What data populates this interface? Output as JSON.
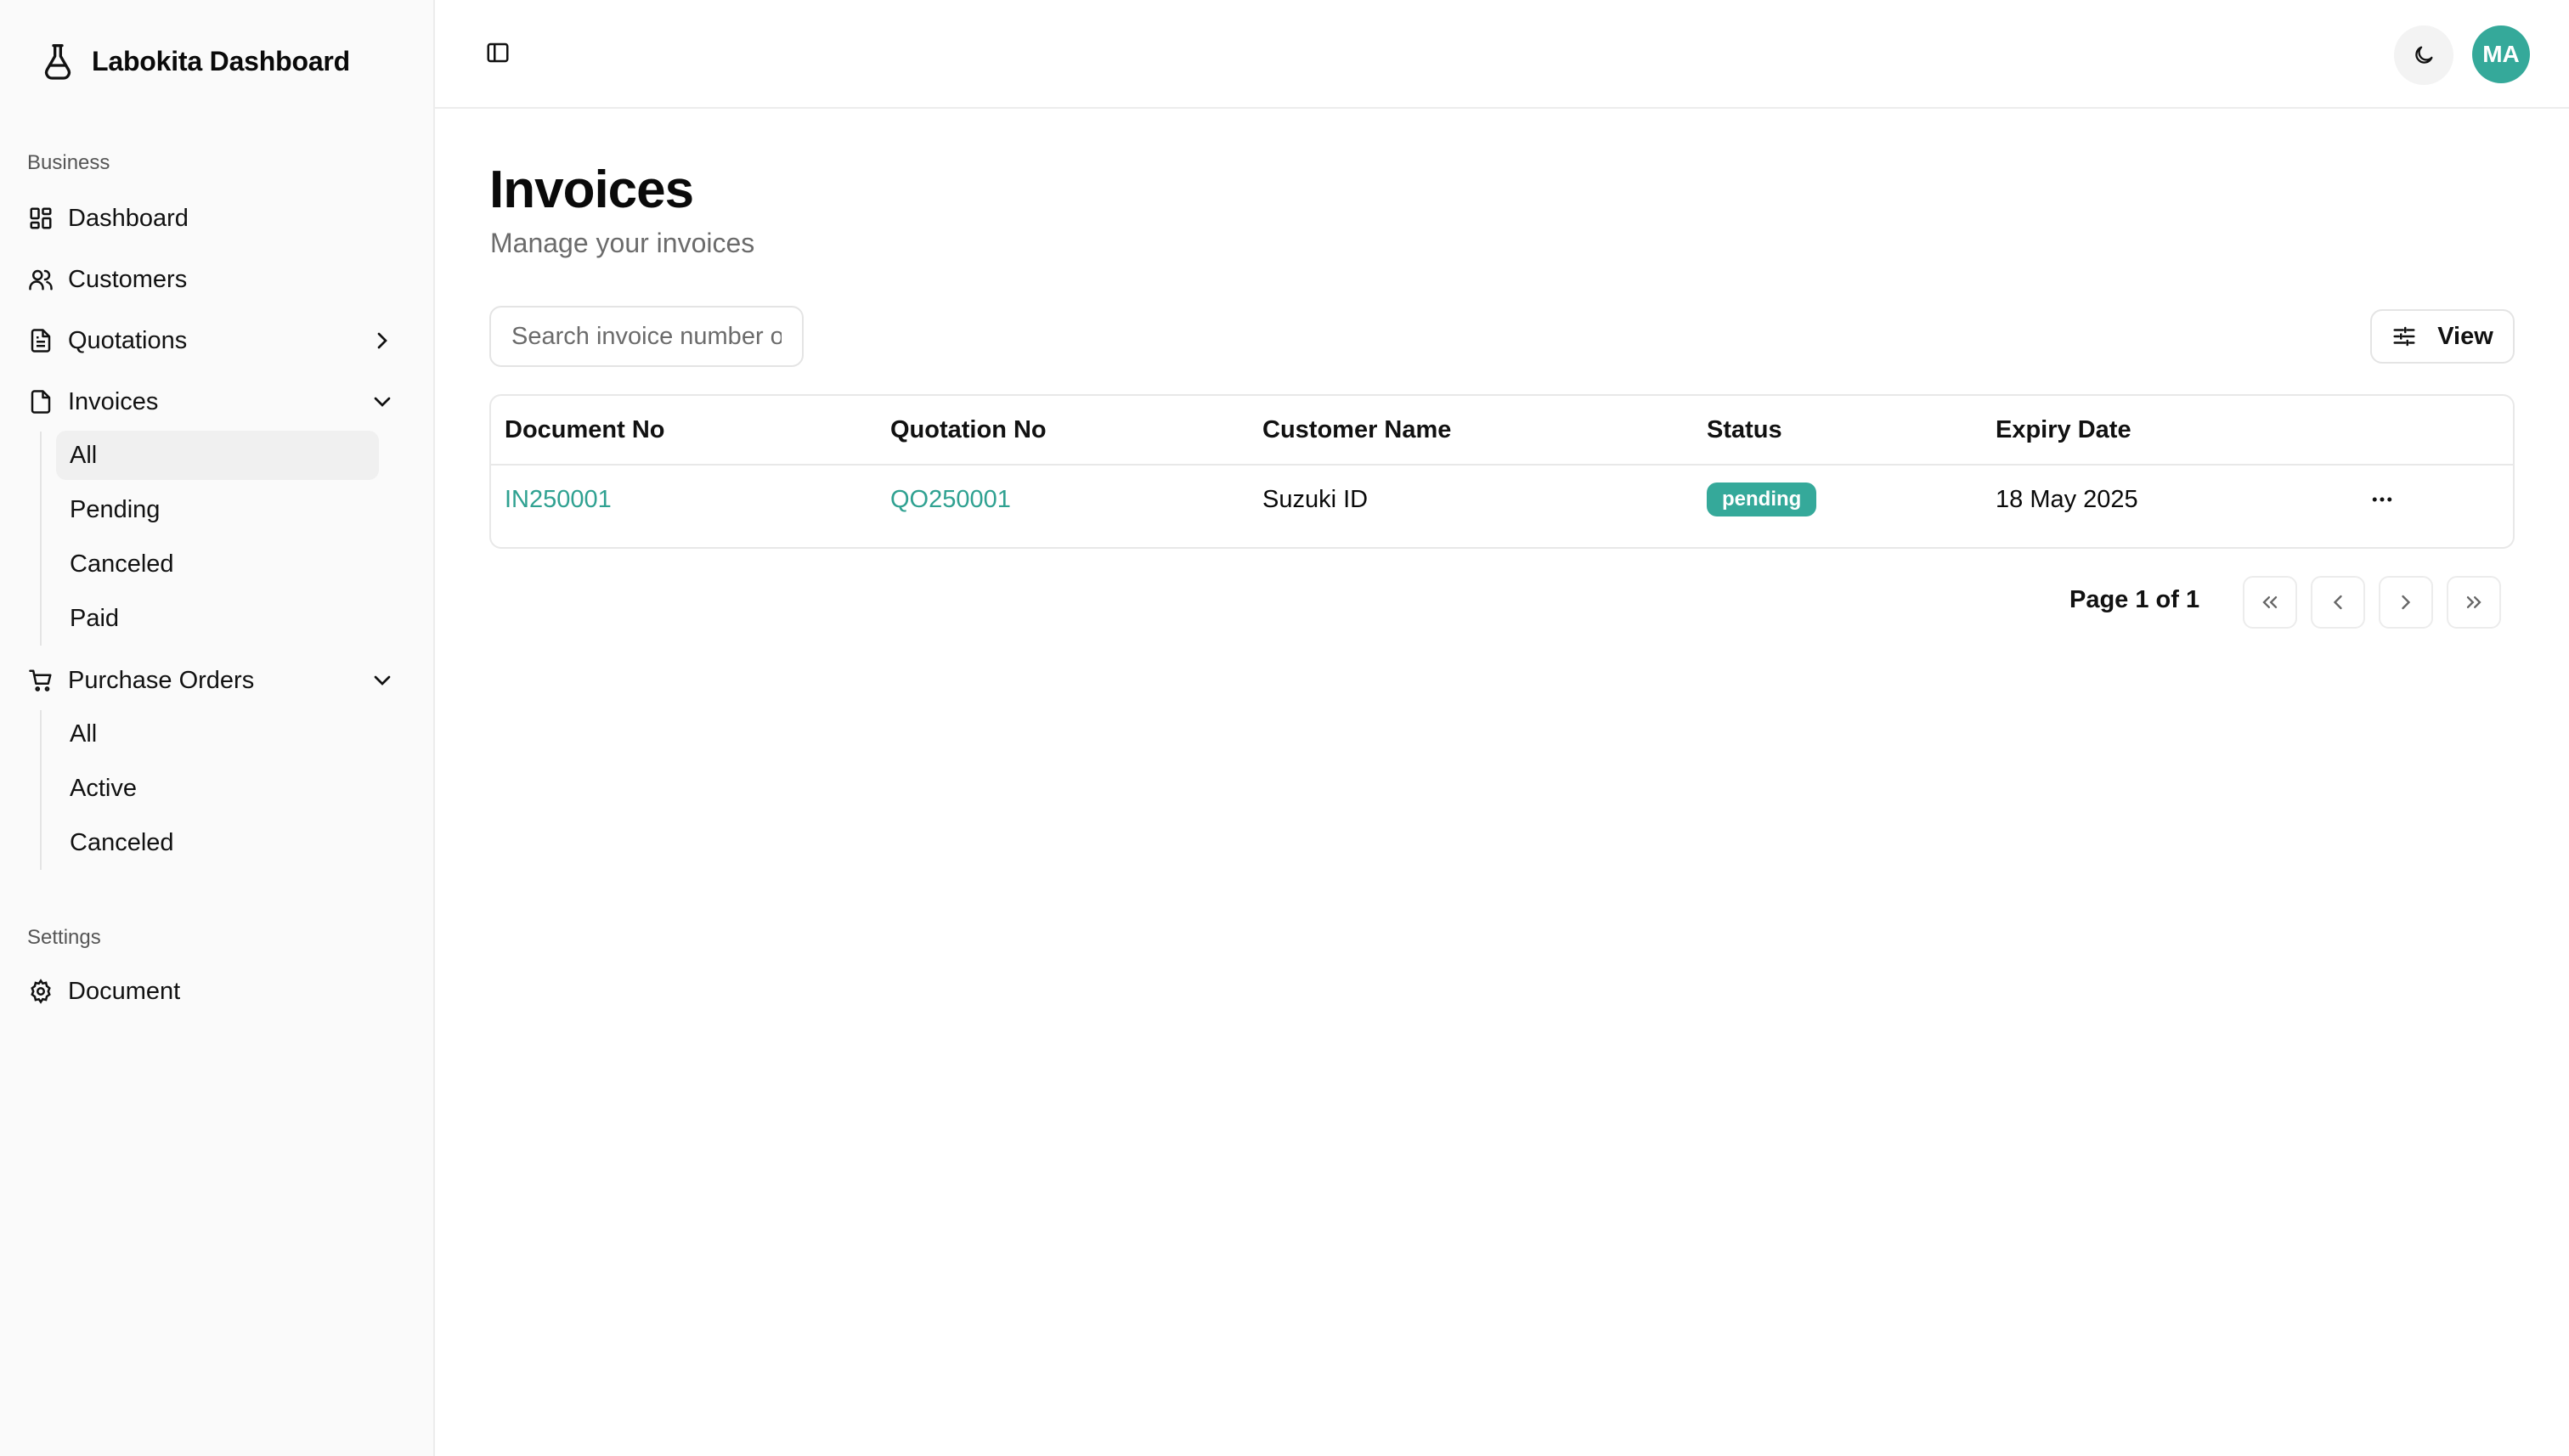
{
  "brand": {
    "name": "Labokita Dashboard",
    "icon": "flask-icon"
  },
  "sidebar": {
    "business_label": "Business",
    "settings_label": "Settings",
    "items": {
      "dashboard": "Dashboard",
      "customers": "Customers",
      "quotations": "Quotations",
      "invoices": "Invoices",
      "purchase_orders": "Purchase Orders",
      "document": "Document"
    },
    "invoice_sub": [
      "All",
      "Pending",
      "Canceled",
      "Paid"
    ],
    "po_sub": [
      "All",
      "Active",
      "Canceled"
    ],
    "active_sub": "All"
  },
  "topbar": {
    "avatar_initials": "MA"
  },
  "main": {
    "title": "Invoices",
    "subtitle": "Manage your invoices",
    "search_placeholder": "Search invoice number or customer",
    "view_label": "View"
  },
  "table": {
    "columns": [
      "Document No",
      "Quotation No",
      "Customer Name",
      "Status",
      "Expiry Date"
    ],
    "rows": [
      {
        "document_no": "IN250001",
        "quotation_no": "QO250001",
        "customer_name": "Suzuki ID",
        "status": "pending",
        "expiry_date": "18 May 2025"
      }
    ]
  },
  "pagination": {
    "text": "Page 1 of 1"
  },
  "colors": {
    "accent": "#35a99a",
    "link": "#2fa191"
  }
}
